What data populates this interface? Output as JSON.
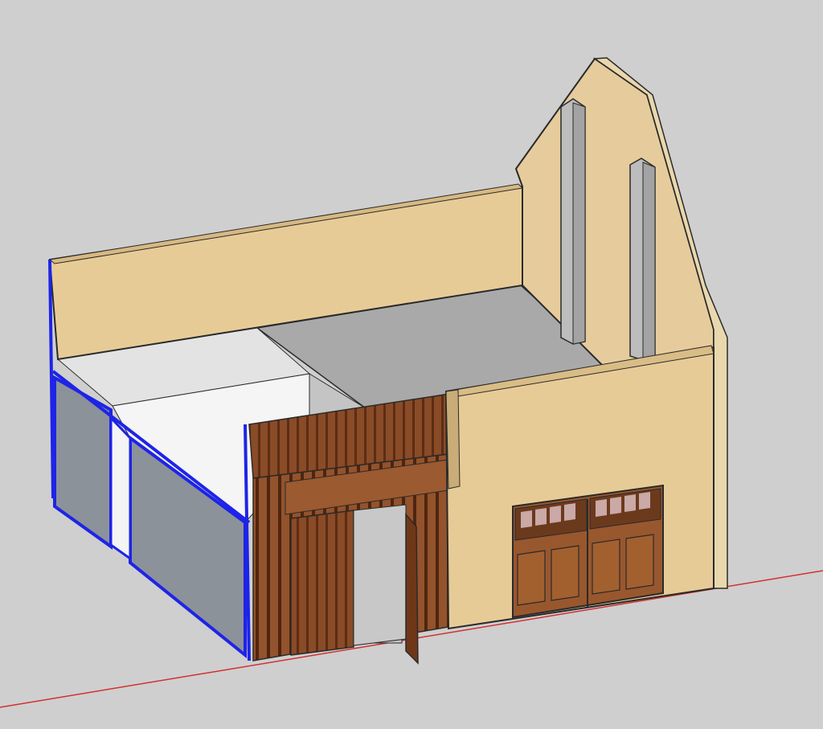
{
  "app": {
    "type": "3d-modeling-viewport"
  },
  "colors": {
    "background": "#cfcfcf",
    "stucco": "#e8cf9f",
    "stucco_shade": "#d9bd86",
    "concrete": "#b9b9b9",
    "floor": "#a7a7a7",
    "wood": "#8a4b27",
    "wood_dark": "#5c2d14",
    "selection": "#1e24e6",
    "axis_red": "#d23030",
    "glass": "#8d939a",
    "white_wall": "#f4f4f4",
    "outline": "#2a2a2a"
  },
  "model": {
    "objects": [
      "back-wall",
      "gable-wall",
      "concrete-column-left",
      "concrete-column-right",
      "floor-slab",
      "front-right-wall",
      "garage-door",
      "wood-slat-facade",
      "entry-door-frame",
      "open-door-leaf",
      "glass-curtain-wall",
      "interior-white-wall"
    ],
    "selected": "glass-curtain-wall",
    "axis": "red-axis"
  }
}
